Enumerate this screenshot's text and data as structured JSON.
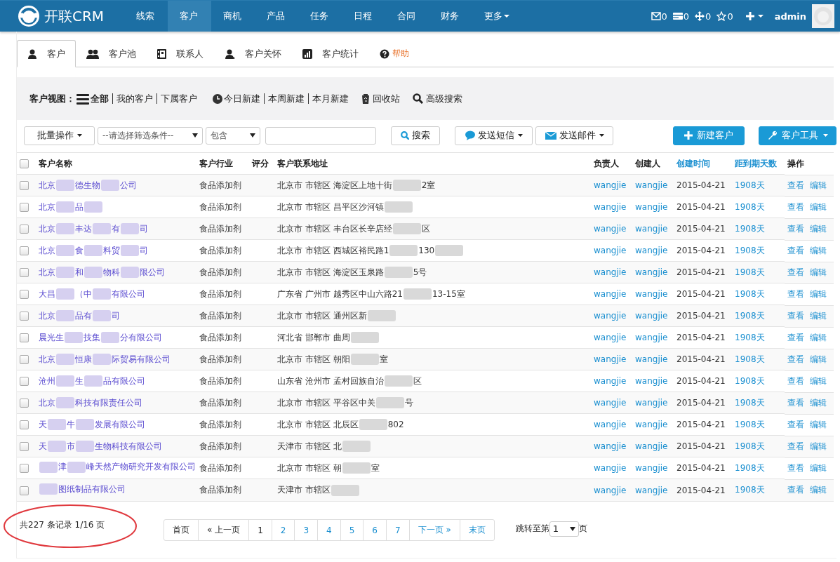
{
  "navbar": {
    "brand": "开联CRM",
    "menu": [
      {
        "label": "线索",
        "selected": false
      },
      {
        "label": "客户",
        "selected": true
      },
      {
        "label": "商机",
        "selected": false
      },
      {
        "label": "产品",
        "selected": false
      },
      {
        "label": "任务",
        "selected": false
      },
      {
        "label": "日程",
        "selected": false
      },
      {
        "label": "合同",
        "selected": false
      },
      {
        "label": "财务",
        "selected": false
      },
      {
        "label": "更多",
        "selected": false,
        "dropdown": true
      }
    ],
    "counters": [
      {
        "kind": "mail",
        "count": "0"
      },
      {
        "kind": "card",
        "count": "0"
      },
      {
        "kind": "move",
        "count": "0"
      },
      {
        "kind": "star",
        "count": "0"
      }
    ],
    "user": "admin"
  },
  "tabs": [
    {
      "kind": "user",
      "label": "客户",
      "selected": true
    },
    {
      "kind": "users",
      "label": "客户池",
      "selected": false
    },
    {
      "kind": "book",
      "label": "联系人",
      "selected": false
    },
    {
      "kind": "care",
      "label": "客户关怀",
      "selected": false
    },
    {
      "kind": "chart",
      "label": "客户统计",
      "selected": false
    },
    {
      "kind": "help",
      "label": "帮助",
      "selected": false
    }
  ],
  "viewbar": {
    "label": "客户视图：",
    "views": [
      {
        "label": "全部",
        "selected": true
      },
      {
        "label": "我的客户",
        "selected": false
      },
      {
        "label": "下属客户",
        "selected": false
      }
    ],
    "periods": [
      "今日新建",
      "本周新建",
      "本月新建"
    ],
    "recycle": "回收站",
    "advanced": "高级搜索"
  },
  "toolbar": {
    "batch": "批量操作",
    "filter_placeholder": "--请选择筛选条件--",
    "operator": "包含",
    "search": "搜索",
    "sms": "发送短信",
    "mail": "发送邮件",
    "new": "新建客户",
    "tools": "客户工具"
  },
  "table": {
    "select_all": {
      "checked": false
    },
    "columns": [
      {
        "label": "客户名称",
        "sortable": false
      },
      {
        "label": "客户行业",
        "sortable": false
      },
      {
        "label": "评分",
        "sortable": false
      },
      {
        "label": "客户联系地址",
        "sortable": false
      },
      {
        "label": "负责人",
        "sortable": false
      },
      {
        "label": "创建人",
        "sortable": false
      },
      {
        "label": "创建时间",
        "sortable": true
      },
      {
        "label": "距到期天数",
        "sortable": true
      },
      {
        "label": "操作",
        "sortable": false
      }
    ],
    "rows": [
      {
        "checked": false,
        "name": [
          {
            "kind": "text",
            "text": "北京"
          },
          {
            "kind": "masked"
          },
          {
            "kind": "text",
            "text": "德生物"
          },
          {
            "kind": "masked"
          },
          {
            "kind": "text",
            "text": "公司"
          }
        ],
        "industry": "食品添加剂",
        "address": [
          {
            "kind": "text",
            "text": "北京市 市辖区 海淀区上地十街"
          },
          {
            "kind": "masked"
          },
          {
            "kind": "text",
            "text": "2室"
          }
        ],
        "owner": "wangjie",
        "creator": "wangjie",
        "created": "2015-04-21",
        "days": "1908天",
        "view": "查看",
        "edit": "编辑"
      },
      {
        "checked": false,
        "name": [
          {
            "kind": "text",
            "text": "北京"
          },
          {
            "kind": "masked"
          },
          {
            "kind": "text",
            "text": "品"
          },
          {
            "kind": "masked"
          }
        ],
        "industry": "食品添加剂",
        "address": [
          {
            "kind": "text",
            "text": "北京市 市辖区 昌平区沙河镇"
          },
          {
            "kind": "masked"
          }
        ],
        "owner": "wangjie",
        "creator": "wangjie",
        "created": "2015-04-21",
        "days": "1908天",
        "view": "查看",
        "edit": "编辑"
      },
      {
        "checked": false,
        "name": [
          {
            "kind": "text",
            "text": "北京"
          },
          {
            "kind": "masked"
          },
          {
            "kind": "text",
            "text": "丰达"
          },
          {
            "kind": "masked"
          },
          {
            "kind": "text",
            "text": "有"
          },
          {
            "kind": "masked"
          },
          {
            "kind": "text",
            "text": "司"
          }
        ],
        "industry": "食品添加剂",
        "address": [
          {
            "kind": "text",
            "text": "北京市 市辖区 丰台区长辛店经"
          },
          {
            "kind": "masked"
          },
          {
            "kind": "text",
            "text": "区"
          }
        ],
        "owner": "wangjie",
        "creator": "wangjie",
        "created": "2015-04-21",
        "days": "1908天",
        "view": "查看",
        "edit": "编辑"
      },
      {
        "checked": false,
        "name": [
          {
            "kind": "text",
            "text": "北京"
          },
          {
            "kind": "masked"
          },
          {
            "kind": "text",
            "text": "食"
          },
          {
            "kind": "masked"
          },
          {
            "kind": "text",
            "text": "料贸"
          },
          {
            "kind": "masked"
          },
          {
            "kind": "text",
            "text": "司"
          }
        ],
        "industry": "食品添加剂",
        "address": [
          {
            "kind": "text",
            "text": "北京市 市辖区 西城区裕民路1"
          },
          {
            "kind": "masked"
          },
          {
            "kind": "text",
            "text": "130"
          },
          {
            "kind": "masked"
          }
        ],
        "owner": "wangjie",
        "creator": "wangjie",
        "created": "2015-04-21",
        "days": "1908天",
        "view": "查看",
        "edit": "编辑"
      },
      {
        "checked": false,
        "name": [
          {
            "kind": "text",
            "text": "北京"
          },
          {
            "kind": "masked"
          },
          {
            "kind": "text",
            "text": "和"
          },
          {
            "kind": "masked"
          },
          {
            "kind": "text",
            "text": "物科"
          },
          {
            "kind": "masked"
          },
          {
            "kind": "text",
            "text": "限公司"
          }
        ],
        "industry": "食品添加剂",
        "address": [
          {
            "kind": "text",
            "text": "北京市 市辖区 海淀区玉泉路"
          },
          {
            "kind": "masked"
          },
          {
            "kind": "text",
            "text": "5号"
          }
        ],
        "owner": "wangjie",
        "creator": "wangjie",
        "created": "2015-04-21",
        "days": "1908天",
        "view": "查看",
        "edit": "编辑"
      },
      {
        "checked": false,
        "name": [
          {
            "kind": "text",
            "text": "大昌"
          },
          {
            "kind": "masked"
          },
          {
            "kind": "text",
            "text": "（中"
          },
          {
            "kind": "masked"
          },
          {
            "kind": "text",
            "text": "有限公司"
          }
        ],
        "industry": "食品添加剂",
        "address": [
          {
            "kind": "text",
            "text": "广东省 广州市 越秀区中山六路21"
          },
          {
            "kind": "masked"
          },
          {
            "kind": "text",
            "text": "13-15室"
          }
        ],
        "owner": "wangjie",
        "creator": "wangjie",
        "created": "2015-04-21",
        "days": "1908天",
        "view": "查看",
        "edit": "编辑"
      },
      {
        "checked": false,
        "name": [
          {
            "kind": "text",
            "text": "北京"
          },
          {
            "kind": "masked"
          },
          {
            "kind": "text",
            "text": "品有"
          },
          {
            "kind": "masked"
          },
          {
            "kind": "text",
            "text": "司"
          }
        ],
        "industry": "食品添加剂",
        "address": [
          {
            "kind": "text",
            "text": "北京市 市辖区 通州区新"
          },
          {
            "kind": "masked"
          }
        ],
        "owner": "wangjie",
        "creator": "wangjie",
        "created": "2015-04-21",
        "days": "1908天",
        "view": "查看",
        "edit": "编辑"
      },
      {
        "checked": false,
        "name": [
          {
            "kind": "text",
            "text": "晨光生"
          },
          {
            "kind": "masked"
          },
          {
            "kind": "text",
            "text": "技集"
          },
          {
            "kind": "masked"
          },
          {
            "kind": "text",
            "text": "分有限公司"
          }
        ],
        "industry": "食品添加剂",
        "address": [
          {
            "kind": "text",
            "text": "河北省 邯郸市 曲周"
          },
          {
            "kind": "masked"
          }
        ],
        "owner": "wangjie",
        "creator": "wangjie",
        "created": "2015-04-21",
        "days": "1908天",
        "view": "查看",
        "edit": "编辑"
      },
      {
        "checked": false,
        "name": [
          {
            "kind": "text",
            "text": "北京"
          },
          {
            "kind": "masked"
          },
          {
            "kind": "text",
            "text": "恒康"
          },
          {
            "kind": "masked"
          },
          {
            "kind": "text",
            "text": "际贸易有限公司"
          }
        ],
        "industry": "食品添加剂",
        "address": [
          {
            "kind": "text",
            "text": "北京市 市辖区 朝阳"
          },
          {
            "kind": "masked"
          },
          {
            "kind": "text",
            "text": "室"
          }
        ],
        "owner": "wangjie",
        "creator": "wangjie",
        "created": "2015-04-21",
        "days": "1908天",
        "view": "查看",
        "edit": "编辑"
      },
      {
        "checked": false,
        "name": [
          {
            "kind": "text",
            "text": "沧州"
          },
          {
            "kind": "masked"
          },
          {
            "kind": "text",
            "text": "生"
          },
          {
            "kind": "masked"
          },
          {
            "kind": "text",
            "text": "品有限公司"
          }
        ],
        "industry": "食品添加剂",
        "address": [
          {
            "kind": "text",
            "text": "山东省 沧州市 孟村回族自治"
          },
          {
            "kind": "masked"
          },
          {
            "kind": "text",
            "text": "区"
          }
        ],
        "owner": "wangjie",
        "creator": "wangjie",
        "created": "2015-04-21",
        "days": "1908天",
        "view": "查看",
        "edit": "编辑"
      },
      {
        "checked": false,
        "name": [
          {
            "kind": "text",
            "text": "北京"
          },
          {
            "kind": "masked"
          },
          {
            "kind": "text",
            "text": "科技有限责任公司"
          }
        ],
        "industry": "食品添加剂",
        "address": [
          {
            "kind": "text",
            "text": "北京市 市辖区 平谷区中关"
          },
          {
            "kind": "masked"
          },
          {
            "kind": "text",
            "text": "号"
          }
        ],
        "owner": "wangjie",
        "creator": "wangjie",
        "created": "2015-04-21",
        "days": "1908天",
        "view": "查看",
        "edit": "编辑"
      },
      {
        "checked": false,
        "name": [
          {
            "kind": "text",
            "text": "天"
          },
          {
            "kind": "masked"
          },
          {
            "kind": "text",
            "text": "牛"
          },
          {
            "kind": "masked"
          },
          {
            "kind": "text",
            "text": "发展有限公司"
          }
        ],
        "industry": "食品添加剂",
        "address": [
          {
            "kind": "text",
            "text": "北京市 市辖区 北辰区"
          },
          {
            "kind": "masked"
          },
          {
            "kind": "text",
            "text": "802"
          }
        ],
        "owner": "wangjie",
        "creator": "wangjie",
        "created": "2015-04-21",
        "days": "1908天",
        "view": "查看",
        "edit": "编辑"
      },
      {
        "checked": false,
        "name": [
          {
            "kind": "text",
            "text": "天"
          },
          {
            "kind": "masked"
          },
          {
            "kind": "text",
            "text": "市"
          },
          {
            "kind": "masked"
          },
          {
            "kind": "text",
            "text": "生物科技有限公司"
          }
        ],
        "industry": "食品添加剂",
        "address": [
          {
            "kind": "text",
            "text": "天津市 市辖区 北"
          },
          {
            "kind": "masked"
          }
        ],
        "owner": "wangjie",
        "creator": "wangjie",
        "created": "2015-04-21",
        "days": "1908天",
        "view": "查看",
        "edit": "编辑"
      },
      {
        "checked": false,
        "name": [
          {
            "kind": "masked"
          },
          {
            "kind": "text",
            "text": "津"
          },
          {
            "kind": "masked"
          },
          {
            "kind": "text",
            "text": "峰天然产物研究开发有限公司"
          }
        ],
        "industry": "食品添加剂",
        "address": [
          {
            "kind": "text",
            "text": "北京市 市辖区 朝"
          },
          {
            "kind": "masked"
          },
          {
            "kind": "text",
            "text": "室"
          }
        ],
        "owner": "wangjie",
        "creator": "wangjie",
        "created": "2015-04-21",
        "days": "1908天",
        "view": "查看",
        "edit": "编辑"
      },
      {
        "checked": false,
        "name": [
          {
            "kind": "masked"
          },
          {
            "kind": "text",
            "text": "图纸制品有限公司"
          }
        ],
        "industry": "食品添加剂",
        "address": [
          {
            "kind": "text",
            "text": "天津市 市辖区 "
          },
          {
            "kind": "masked"
          }
        ],
        "owner": "wangjie",
        "creator": "wangjie",
        "created": "2015-04-21",
        "days": "1908天",
        "view": "查看",
        "edit": "编辑"
      }
    ]
  },
  "pager": {
    "summary": "共227 条记录 1/16 页",
    "first": "首页",
    "prev": "« 上一页",
    "pages": [
      {
        "label": "1",
        "selected": true
      },
      {
        "label": "2",
        "selected": false
      },
      {
        "label": "3",
        "selected": false
      },
      {
        "label": "4",
        "selected": false
      },
      {
        "label": "5",
        "selected": false
      },
      {
        "label": "6",
        "selected": false
      },
      {
        "label": "7",
        "selected": false
      }
    ],
    "next": "下一页 »",
    "last": "末页",
    "jump_label": "跳转至第",
    "jump_value": "1",
    "jump_suffix": "页"
  }
}
